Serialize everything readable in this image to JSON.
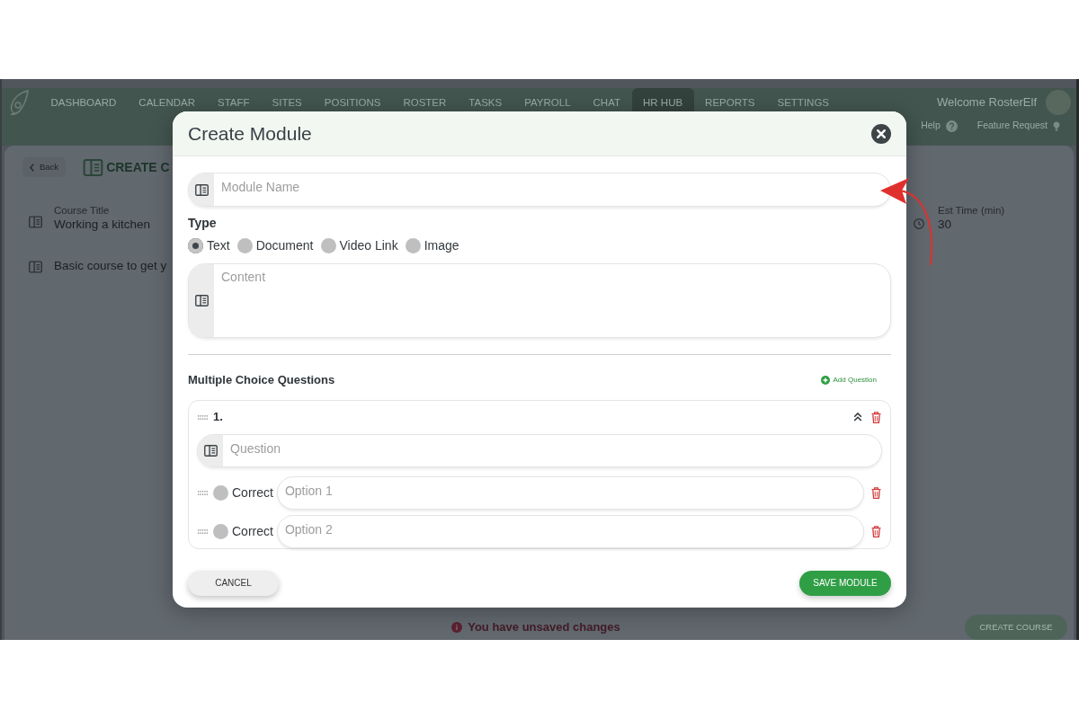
{
  "app": {
    "nav": {
      "items": [
        {
          "label": "DASHBOARD",
          "selected": false
        },
        {
          "label": "CALENDAR",
          "selected": false
        },
        {
          "label": "STAFF",
          "selected": false
        },
        {
          "label": "SITES",
          "selected": false
        },
        {
          "label": "POSITIONS",
          "selected": false
        },
        {
          "label": "ROSTER",
          "selected": false
        },
        {
          "label": "TASKS",
          "selected": false
        },
        {
          "label": "PAYROLL",
          "selected": false
        },
        {
          "label": "CHAT",
          "selected": false
        },
        {
          "label": "HR HUB",
          "selected": true
        },
        {
          "label": "REPORTS",
          "selected": false
        },
        {
          "label": "SETTINGS",
          "selected": false
        }
      ],
      "welcome": "Welcome RosterElf",
      "links": [
        {
          "label": "Help",
          "kind": "help"
        },
        {
          "label": "Feature Request",
          "kind": "idea"
        }
      ]
    },
    "page": {
      "back": "Back",
      "heading": "CREATE C",
      "fields": [
        {
          "label": "Course Title",
          "value": "Working a kitchen"
        },
        {
          "value": "Basic course to get y"
        }
      ],
      "side_field": {
        "label": "Est Time (min)",
        "value": "30"
      }
    },
    "footer": {
      "notice": "You have unsaved changes",
      "button": "CREATE COURSE"
    }
  },
  "modal": {
    "title": "Create Module",
    "module_name": {
      "placeholder": "Module Name"
    },
    "type": {
      "label": "Type",
      "options": [
        {
          "label": "Text",
          "selected": true
        },
        {
          "label": "Document",
          "selected": false
        },
        {
          "label": "Video Link",
          "selected": false
        },
        {
          "label": "Image",
          "selected": false
        }
      ]
    },
    "content": {
      "placeholder": "Content"
    },
    "questions_section": {
      "title": "Multiple Choice Questions",
      "add_button": "Add Question"
    },
    "questions": [
      {
        "number": "1.",
        "expanded": true,
        "question": {
          "placeholder": "Question"
        },
        "options": [
          {
            "label": "Correct",
            "correct": false,
            "placeholder": "Option 1"
          },
          {
            "label": "Correct",
            "correct": false,
            "placeholder": "Option 2"
          }
        ]
      }
    ],
    "buttons": {
      "cancel": "CANCEL",
      "save": "SAVE MODULE"
    }
  }
}
